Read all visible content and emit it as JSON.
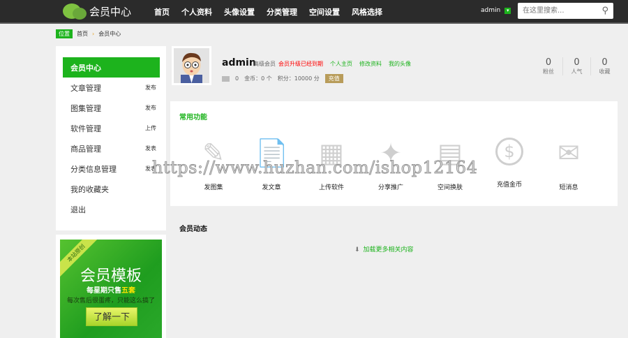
{
  "header": {
    "logo_text": "会员中心",
    "nav": [
      "首页",
      "个人资料",
      "头像设置",
      "分类管理",
      "空间设置",
      "风格选择"
    ],
    "username": "admin",
    "dropdown_icon": "chevron-down-icon",
    "search_placeholder": "在这里搜索...",
    "search_icon": "search-icon"
  },
  "breadcrumb": {
    "label": "位置",
    "items": [
      "首页",
      "会员中心"
    ]
  },
  "sidebar": {
    "items": [
      {
        "label": "会员中心",
        "action": ""
      },
      {
        "label": "文章管理",
        "action": "发布"
      },
      {
        "label": "图集管理",
        "action": "发布"
      },
      {
        "label": "软件管理",
        "action": "上传"
      },
      {
        "label": "商品管理",
        "action": "发表"
      },
      {
        "label": "分类信息管理",
        "action": "发表"
      },
      {
        "label": "我的收藏夹",
        "action": ""
      },
      {
        "label": "退出",
        "action": ""
      }
    ]
  },
  "ad": {
    "ribbon": "本站原创",
    "title": "会员模板",
    "sub_prefix": "每星期只售",
    "sub_highlight": "五套",
    "sub2": "每次售后很蛋疼，只能这么搞了",
    "button": "了解一下"
  },
  "profile": {
    "name": "admin",
    "level": "高级会员",
    "warning": "会员升级已经到期",
    "links": [
      "个人主页",
      "修改资料",
      "我的头像"
    ],
    "messages": "0",
    "coins": "金币：0 个",
    "points": "积分：10000 分",
    "charge": "充值",
    "stats": [
      {
        "value": "0",
        "label": "粉丝"
      },
      {
        "value": "0",
        "label": "人气"
      },
      {
        "value": "0",
        "label": "收藏"
      }
    ]
  },
  "functions": {
    "title": "常用功能",
    "items": [
      {
        "label": "发图集",
        "icon": "edit-icon"
      },
      {
        "label": "发文章",
        "icon": "document-icon"
      },
      {
        "label": "上传软件",
        "icon": "upload-software-icon"
      },
      {
        "label": "分享推广",
        "icon": "share-icon"
      },
      {
        "label": "空间换肤",
        "icon": "skin-icon"
      },
      {
        "label": "充值金币",
        "icon": "dollar-icon"
      },
      {
        "label": "短消息",
        "icon": "envelope-icon"
      }
    ]
  },
  "activity": {
    "title": "会员动态",
    "load_more": "加载更多相关内容"
  },
  "watermark": "https://www.huzhan.com/ishop12164",
  "colors": {
    "accent": "#1db31d",
    "header": "#2b2b2b",
    "warning": "#ff0000"
  }
}
